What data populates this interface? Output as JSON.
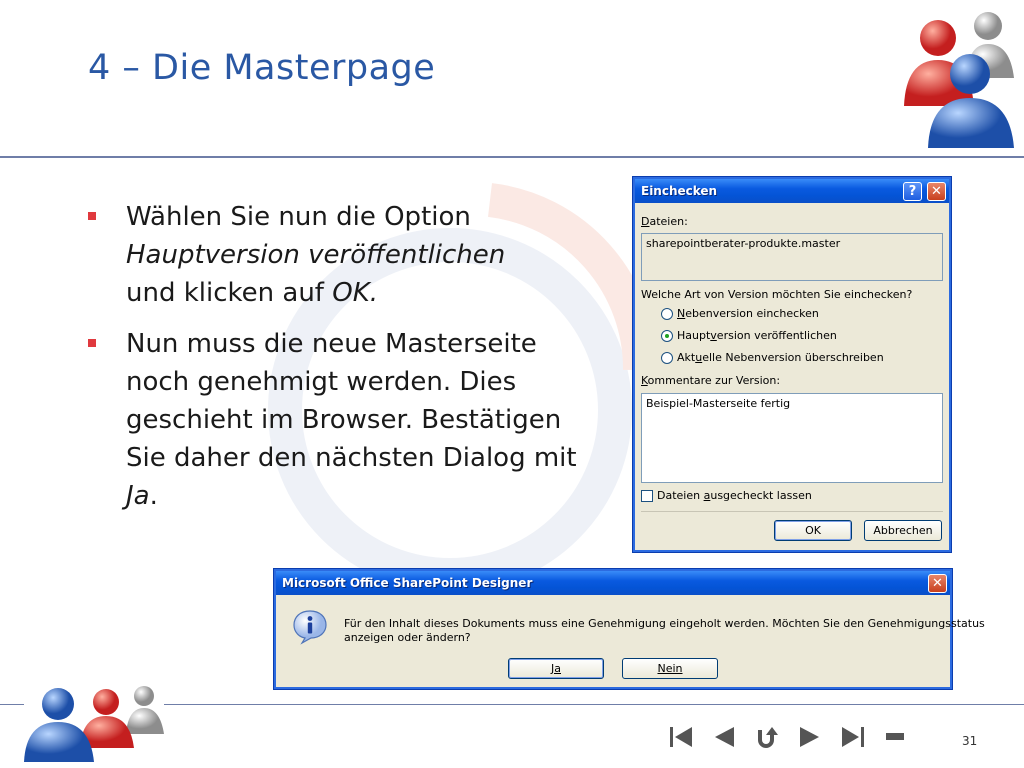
{
  "slide": {
    "title": "4 – Die Masterpage",
    "page_number": "31"
  },
  "bullets": [
    {
      "line1": "Wählen Sie nun die Option",
      "line2_italic": "Hauptversion veröffentlichen",
      "line3_plain": "und klicken auf ",
      "line3_italic": "OK."
    },
    {
      "plain": "Nun muss die neue Masterseite noch genehmigt werden. Dies geschieht im Browser. Bestätigen Sie daher den nächsten Dialog mit ",
      "italic": "Ja",
      "tail": "."
    }
  ],
  "checkin_dialog": {
    "title": "Einchecken",
    "help_label": "?",
    "files_label": {
      "underlined": "D",
      "rest": "ateien:"
    },
    "file_value": "sharepointberater-produkte.master",
    "question": "Welche Art von Version möchten Sie einchecken?",
    "options": [
      {
        "pre": "",
        "u": "N",
        "post": "ebenversion einchecken",
        "selected": false
      },
      {
        "pre": "Haupt",
        "u": "v",
        "post": "ersion veröffentlichen",
        "selected": true
      },
      {
        "pre": "Akt",
        "u": "u",
        "post": "elle Nebenversion überschreiben",
        "selected": false
      }
    ],
    "comments_label": {
      "underlined": "K",
      "rest": "ommentare zur Version:"
    },
    "comment_value": "Beispiel-Masterseite fertig",
    "keep_checked_out": {
      "pre": "Dateien ",
      "u": "a",
      "post": "usgecheckt lassen",
      "checked": false
    },
    "ok_label": "OK",
    "cancel_label": "Abbrechen"
  },
  "message_box": {
    "title": "Microsoft Office SharePoint Designer",
    "icon": "info-icon",
    "message_line1": "Für den Inhalt dieses Dokuments muss eine Genehmigung eingeholt werden. Möchten Sie den Genehmigungsstatus",
    "message_line2": "anzeigen oder ändern?",
    "yes_label": "Ja",
    "no_label": "Nein"
  },
  "colors": {
    "title": "#2a58a4",
    "bullet": "#e0393e",
    "xp_titlebar": "#0a5ae0",
    "xp_face": "#ece9d8"
  },
  "nav_icons": [
    "first-slide-icon",
    "previous-slide-icon",
    "return-icon",
    "next-slide-icon",
    "last-slide-icon",
    "end-show-icon"
  ]
}
